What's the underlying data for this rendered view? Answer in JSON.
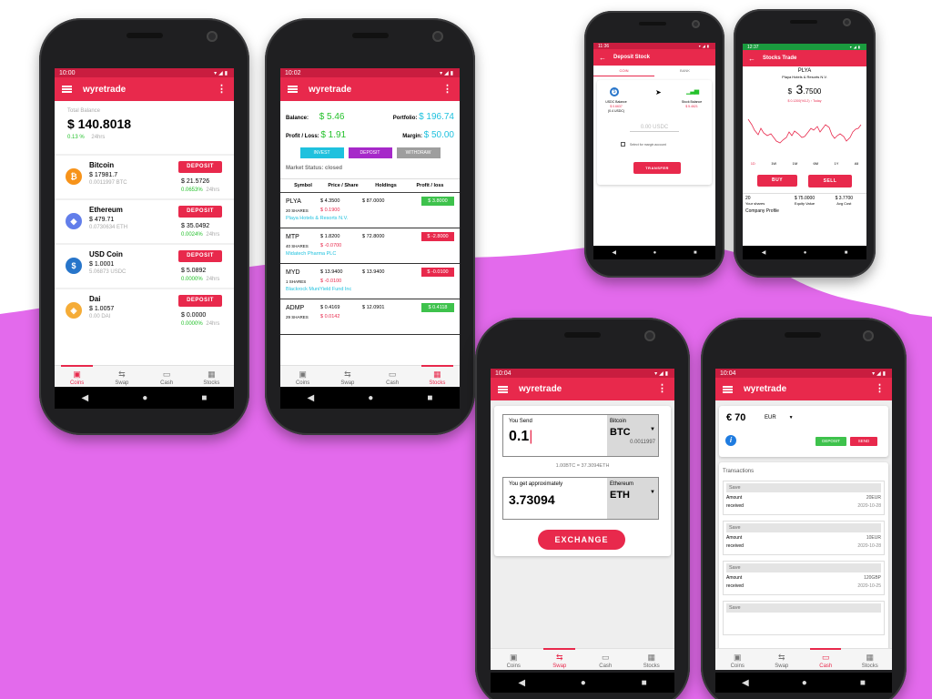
{
  "colors": {
    "brand": "#e8294c",
    "blob": "#e36aec",
    "green": "#24c12b",
    "cyan": "#1fc1de",
    "purple": "#a629c9"
  },
  "tabs": [
    "Coins",
    "Swap",
    "Cash",
    "Stocks"
  ],
  "phone1": {
    "time": "10:00",
    "app_title": "wyretrade",
    "total_label": "Total Balance",
    "total_value": "$ 140.8018",
    "total_change": "0.13 %",
    "total_period": "24hrs",
    "deposit_label": "DEPOSIT",
    "coins": [
      {
        "name": "Bitcoin",
        "price": "$ 17981.7",
        "amount": "0.0011997 BTC",
        "value": "$ 21.5726",
        "change": "0.0653%",
        "period": "24hrs",
        "icon": "bitcoin-icon",
        "color": "#f7931a",
        "glyph": "₿"
      },
      {
        "name": "Ethereum",
        "price": "$ 479.71",
        "amount": "0.0730634 ETH",
        "value": "$ 35.0492",
        "change": "0.0024%",
        "period": "24hrs",
        "icon": "ethereum-icon",
        "color": "#627eea",
        "glyph": "◆"
      },
      {
        "name": "USD Coin",
        "price": "$ 1.0001",
        "amount": "5.06873 USDC",
        "value": "$ 5.0892",
        "change": "0.0000%",
        "period": "24hrs",
        "icon": "usdc-icon",
        "color": "#2775ca",
        "glyph": "$"
      },
      {
        "name": "Dai",
        "price": "$ 1.0057",
        "amount": "0.00 DAI",
        "value": "$ 0.0000",
        "change": "0.0000%",
        "period": "24hrs",
        "icon": "dai-icon",
        "color": "#f5ac37",
        "glyph": "◈"
      }
    ]
  },
  "phone2": {
    "time": "10:02",
    "app_title": "wyretrade",
    "balance_label": "Balance:",
    "balance_value": "$ 5.46",
    "portfolio_label": "Portfolio:",
    "portfolio_value": "$ 196.74",
    "pl_label": "Profit / Loss:",
    "pl_value": "$ 1.91",
    "margin_label": "Margin:",
    "margin_value": "$ 50.00",
    "invest": "INVEST",
    "deposit": "DEPOSIT",
    "withdraw": "WITHDRAW",
    "market_status": "Market Status: closed",
    "headers": [
      "Symbol",
      "Price / Share",
      "Holdings",
      "Profit / loss"
    ],
    "rows": [
      {
        "symbol": "PLYA",
        "price": "$ 4.3500",
        "holdings": "$ 87.0000",
        "pl": "$ 3.8000",
        "shares": "20 SHARES",
        "change": "$ 0.1900",
        "company": "Playa Hotels & Resorts N.V.",
        "positive": true
      },
      {
        "symbol": "MTP",
        "price": "$ 1.8200",
        "holdings": "$ 72.8000",
        "pl": "$ -2.8000",
        "shares": "40 SHARES",
        "change": "$ -0.0700",
        "company": "Midatech Pharma PLC",
        "positive": false
      },
      {
        "symbol": "MYD",
        "price": "$ 13.9400",
        "holdings": "$ 13.9400",
        "pl": "$ -0.0100",
        "shares": "1 SHARES",
        "change": "$ -0.0100",
        "company": "Blackrock MuniYield Fund Inc",
        "positive": false
      },
      {
        "symbol": "ADMP",
        "price": "$ 0.4169",
        "holdings": "$ 12.0901",
        "pl": "$ 0.4118",
        "shares": "29 SHARES",
        "change": "$ 0.0142",
        "company": "",
        "positive": true
      }
    ]
  },
  "phone3": {
    "time": "11:36",
    "title": "Deposit Stock",
    "tab_coin": "COIN",
    "tab_bank": "BANK",
    "left_label": "USDC Balance",
    "left_value": "$ 0.6637",
    "left_sub": "(0.4 USDC)",
    "right_label": "Stock Balance",
    "right_value": "$ 5.4621",
    "amount_placeholder": "0.00 USDC",
    "margin_check": "Select for margin account",
    "transfer": "TRANSFER"
  },
  "phone4": {
    "time": "12:37",
    "title": "Stocks Trade",
    "symbol": "PLYA",
    "company": "Playa Hotels & Resorts N.V.",
    "price_prefix": "$",
    "price_int": "3",
    "price_dec": ".7500",
    "change": "$ 0.1200(%3.2) ↑ Today",
    "ranges": [
      "1D",
      "1W",
      "1M",
      "6M",
      "1Y",
      "All"
    ],
    "buy": "BUY",
    "sell": "SELL",
    "shares_value": "20",
    "shares_label": "Your shares",
    "equity_value": "$ 75.0000",
    "equity_label": "Equity Value",
    "avg_value": "$ 3.7700",
    "avg_label": "Avg Cost",
    "profile": "Company Profile"
  },
  "phone5": {
    "time": "10:04",
    "app_title": "wyretrade",
    "send_label": "You Send",
    "send_value": "0.1",
    "send_coin_name": "Bitcoin",
    "send_coin": "BTC",
    "send_balance": "0.0011997",
    "rate": "1.00BTC = 37.3094ETH",
    "get_label": "You get approximately",
    "get_value": "3.73094",
    "get_coin_name": "Ethereum",
    "get_coin": "ETH",
    "exchange": "EXCHANGE"
  },
  "phone6": {
    "time": "10:04",
    "app_title": "wyretrade",
    "balance": "€ 70",
    "currency": "EUR",
    "deposit": "DEPOSIT",
    "send": "SEND",
    "transactions_title": "Transactions",
    "transactions": [
      {
        "type": "Save",
        "amount_label": "Amount",
        "amount": "20EUR",
        "status": "received",
        "date": "2020-10-28"
      },
      {
        "type": "Save",
        "amount_label": "Amount",
        "amount": "10EUR",
        "status": "received",
        "date": "2020-10-28"
      },
      {
        "type": "Save",
        "amount_label": "Amount",
        "amount": "120GBP",
        "status": "received",
        "date": "2020-10-25"
      },
      {
        "type": "Save"
      }
    ]
  }
}
